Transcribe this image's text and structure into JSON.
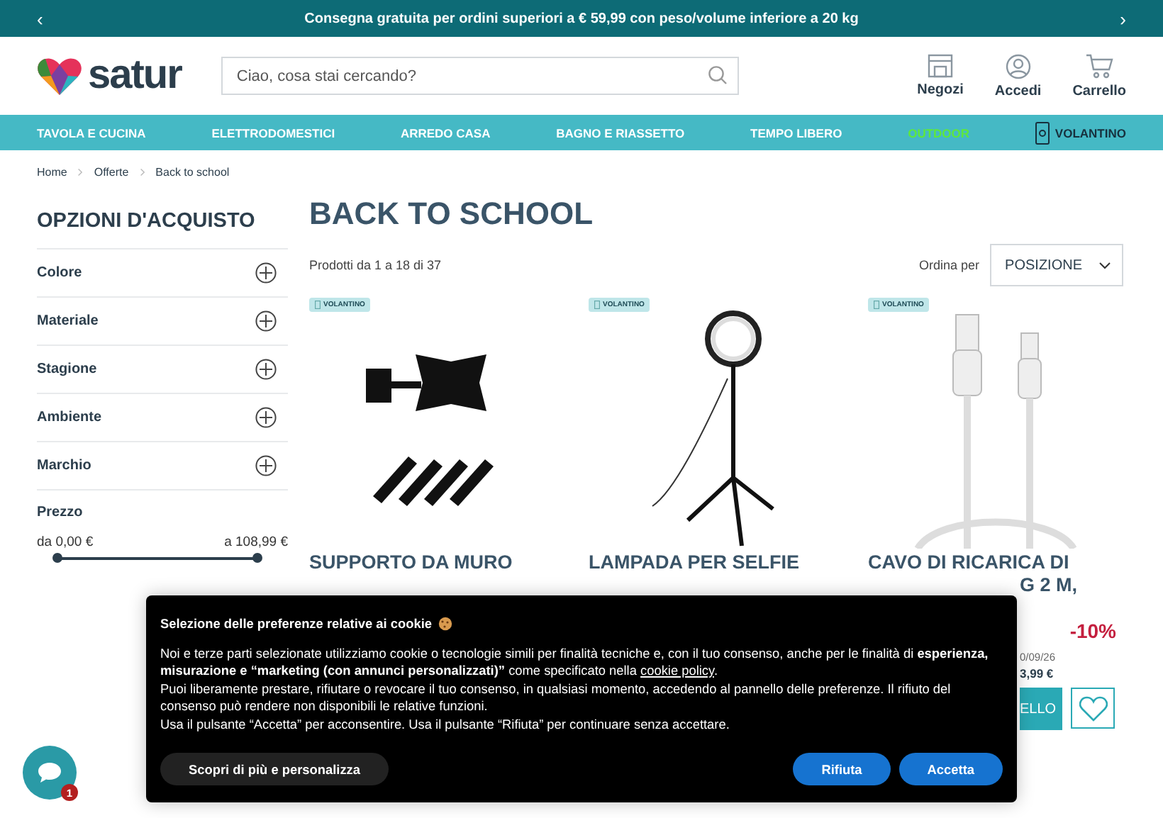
{
  "promo_bar": {
    "prev": "‹",
    "text": "Consegna gratuita per ordini superiori a € 59,99 con peso/volume inferiore a 20 kg",
    "next": "›"
  },
  "header": {
    "logo": "satur",
    "search": {
      "placeholder": "Ciao, cosa stai cercando?"
    },
    "actions": [
      {
        "kind": "store",
        "label": "Negozi"
      },
      {
        "kind": "account",
        "label": "Accedi"
      },
      {
        "kind": "cart",
        "label": "Carrello"
      }
    ]
  },
  "nav": [
    {
      "label": "TAVOLA E CUCINA",
      "kind": "link",
      "color": "#ffffff"
    },
    {
      "label": "ELETTRODOMESTICI",
      "kind": "link",
      "color": "#ffffff"
    },
    {
      "label": "ARREDO CASA",
      "kind": "link",
      "color": "#ffffff"
    },
    {
      "label": "BAGNO E RIASSETTO",
      "kind": "link",
      "color": "#ffffff"
    },
    {
      "label": "TEMPO LIBERO",
      "kind": "link",
      "color": "#ffffff"
    },
    {
      "label": "OUTDOOR",
      "kind": "link",
      "color": "#5ee83c"
    },
    {
      "label": "VOLANTINO",
      "kind": "flyer",
      "color": "#17303d"
    }
  ],
  "breadcrumb": [
    "Home",
    "Offerte",
    "Back to school"
  ],
  "sidebar": {
    "title": "OPZIONI D'ACQUISTO",
    "filters": [
      {
        "label": "Colore",
        "expanded": false
      },
      {
        "label": "Materiale",
        "expanded": false
      },
      {
        "label": "Stagione",
        "expanded": false
      },
      {
        "label": "Ambiente",
        "expanded": false
      },
      {
        "label": "Marchio",
        "expanded": false
      }
    ],
    "price": {
      "label": "Prezzo",
      "min": "da 0,00 €",
      "max": "a 108,99 €",
      "thumbs": [
        {
          "level": 0
        },
        {
          "level": 1
        }
      ]
    }
  },
  "main": {
    "title": "BACK TO SCHOOL",
    "count": "Prodotti da 1 a 18 di 37",
    "sort": {
      "label": "Ordina per",
      "value": "POSIZIONE"
    },
    "products": [
      {
        "badge": "VOLANTINO",
        "kind": "wall-mount",
        "title_lines": [
          "SUPPORTO DA MURO"
        ]
      },
      {
        "badge": "VOLANTINO",
        "kind": "ring-light",
        "title_lines": [
          "LAMPADA PER SELFIE"
        ]
      },
      {
        "badge": "VOLANTINO",
        "kind": "cable",
        "title_lines": [
          "CAVO DI RICARICA DI",
          "G 2 M,"
        ],
        "discount": "-10%",
        "date": "0/09/26",
        "price": "3,99 €",
        "button": "ELLO"
      }
    ]
  },
  "cookie_banner": {
    "title": "Selezione delle preferenze relative ai cookie",
    "text_before": "Noi e terze parti selezionate utilizziamo cookie o tecnologie simili per finalità tecniche e, con il tuo consenso, anche per le finalità di **esperienza, misurazione e “marketing (con annunci personalizzati)”** come specificato nella",
    "link": "cookie policy",
    "text_after": ".",
    "paragraphs": [
      "Puoi liberamente prestare, rifiutare o revocare il tuo consenso, in qualsiasi momento, accedendo al pannello delle preferenze. Il rifiuto del consenso può rendere non disponibili le relative funzioni.",
      "Usa il pulsante “Accetta” per acconsentire. Usa il pulsante “Rifiuta” per continuare senza accettare."
    ],
    "buttons": [
      {
        "kind": "secondary",
        "label": "Scopri di più e personalizza"
      },
      {
        "kind": "primary",
        "label": "Rifiuta"
      },
      {
        "kind": "primary",
        "label": "Accetta"
      }
    ]
  },
  "chat": {
    "badge": "1"
  }
}
